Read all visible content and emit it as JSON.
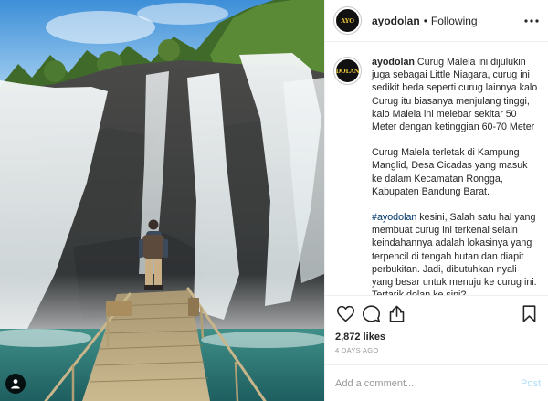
{
  "account": {
    "username": "ayodolan",
    "follow_state": "Following",
    "avatar_text": [
      "AYO",
      "DOLAN"
    ]
  },
  "caption": {
    "username": "ayodolan",
    "paragraph_1": "Curug Malela ini dijulukin juga sebagai Little Niagara, curug ini sedikit beda seperti curug lainnya kalo Curug itu biasanya menjulang tinggi, kalo Malela ini melebar sekitar 50 Meter dengan ketinggian 60-70 Meter",
    "paragraph_2": "Curug Malela terletak di Kampung Manglid, Desa Cicadas yang masuk ke dalam Kecamatan Rongga, Kabupaten Bandung Barat.",
    "hashtag": "#ayodolan",
    "paragraph_3": " kesini, Salah satu hal yang membuat curug ini terkenal selain keindahannya adalah lokasinya yang terpencil di tengah hutan dan diapit perbukitan. Jadi, dibutuhkan nyali yang besar untuk menuju ke curug ini. Tertarik dolan ke sini?"
  },
  "engagement": {
    "likes": "2,872 likes",
    "timestamp": "4 DAYS AGO"
  },
  "comment_form": {
    "placeholder": "Add a comment...",
    "post_label": "Post"
  },
  "icons": [
    "heart-icon",
    "comment-icon",
    "share-icon",
    "save-icon",
    "more-icon",
    "user-tag-icon"
  ],
  "colors": {
    "text": "#262626",
    "muted": "#999999",
    "hashtag": "#003569",
    "post_disabled": "#b2dffc",
    "divider": "#efefef"
  }
}
